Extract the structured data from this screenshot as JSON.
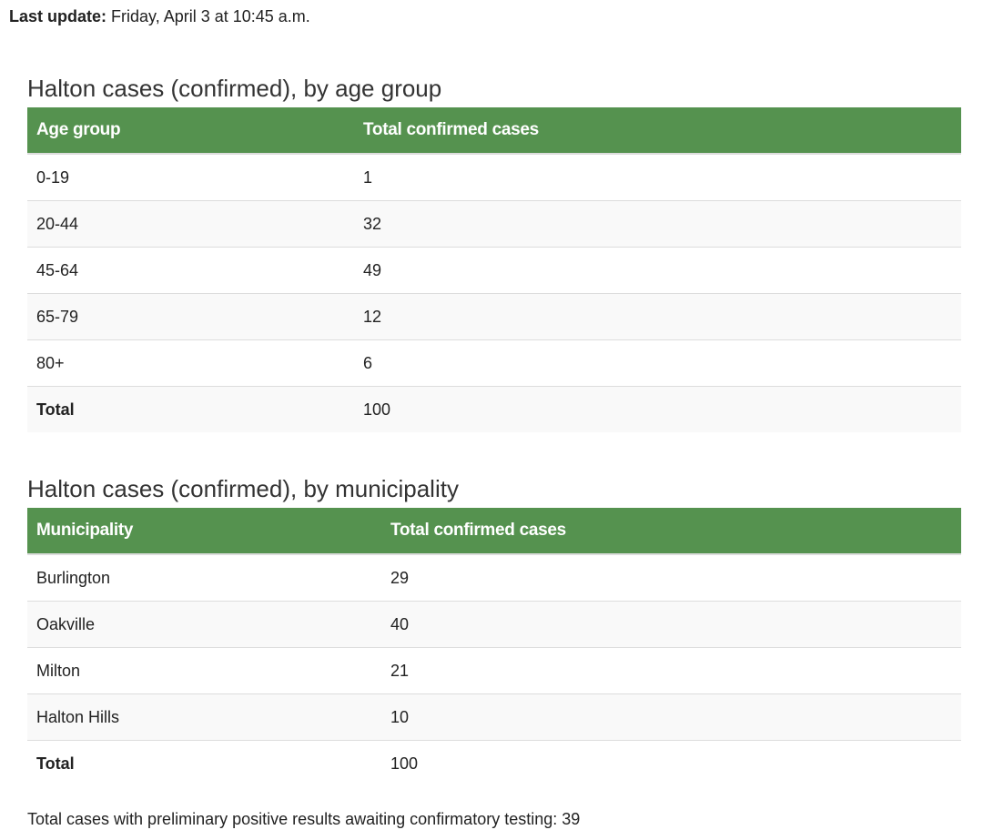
{
  "last_update": {
    "label": "Last update:",
    "value": "Friday, April 3 at 10:45 a.m."
  },
  "age_section": {
    "title": "Halton cases (confirmed), by age group",
    "headers": [
      "Age group",
      "Total confirmed cases"
    ],
    "rows": [
      {
        "label": "0-19",
        "value": "1"
      },
      {
        "label": "20-44",
        "value": "32"
      },
      {
        "label": "45-64",
        "value": "49"
      },
      {
        "label": "65-79",
        "value": "12"
      },
      {
        "label": "80+",
        "value": "6"
      },
      {
        "label": "Total",
        "value": "100"
      }
    ]
  },
  "municipality_section": {
    "title": "Halton cases (confirmed), by municipality",
    "headers": [
      "Municipality",
      "Total confirmed cases"
    ],
    "rows": [
      {
        "label": "Burlington",
        "value": "29"
      },
      {
        "label": "Oakville",
        "value": "40"
      },
      {
        "label": "Milton",
        "value": "21"
      },
      {
        "label": "Halton Hills",
        "value": "10"
      },
      {
        "label": "Total",
        "value": "100"
      }
    ]
  },
  "footnote": "Total cases with preliminary positive results awaiting confirmatory testing: 39",
  "colors": {
    "header_bg": "#55924f",
    "header_text": "#ffffff",
    "stripe_bg": "#f9f9f9"
  }
}
